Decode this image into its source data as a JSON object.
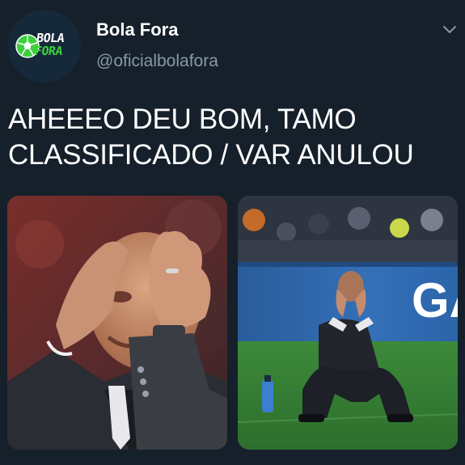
{
  "tweet": {
    "author": {
      "display_name": "Bola Fora",
      "handle": "@oficialbolafora",
      "avatar": {
        "logo_line1": "BOLA",
        "logo_line2": "FORA",
        "ball_icon": "soccer-ball-icon",
        "line2_color": "#3ecf3e"
      }
    },
    "menu_icon": "chevron-down-icon",
    "text_lines": [
      "AHEEEO DEU BOM, TAMO",
      "CLASSIFICADO / VAR ANULOU"
    ],
    "media": [
      {
        "name": "photo-left"
      },
      {
        "name": "photo-right",
        "banner_text": "GA"
      }
    ]
  },
  "colors": {
    "background": "#15202b",
    "primary_text": "#ffffff",
    "secondary_text": "#8899a6"
  }
}
